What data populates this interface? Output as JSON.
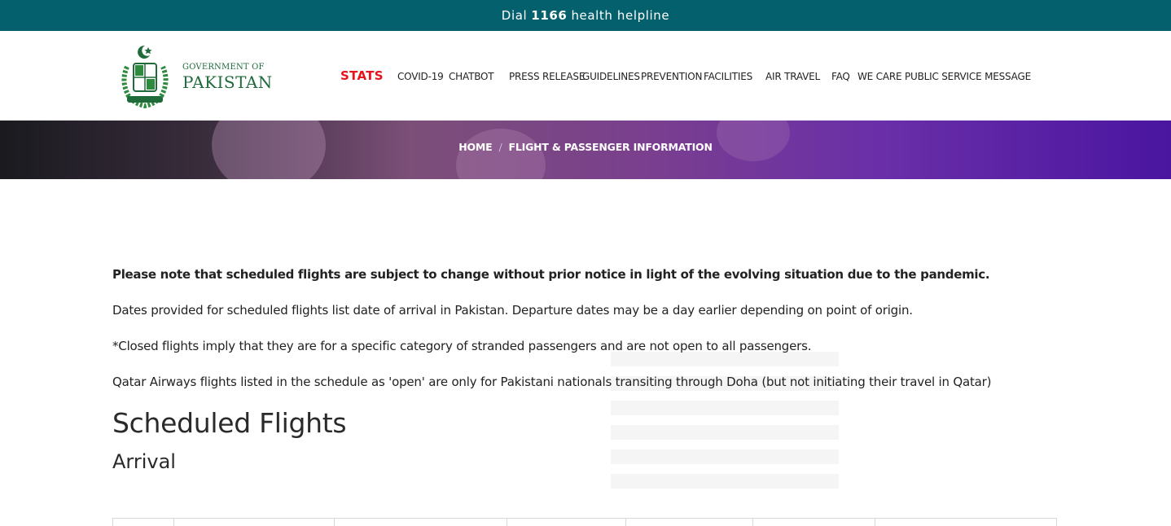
{
  "topbar": {
    "prefix": "Dial",
    "number": "1166",
    "suffix": "health helpline"
  },
  "logo": {
    "line1": "GOVERNMENT OF",
    "line2": "PAKISTAN"
  },
  "nav": {
    "stats": "STATS",
    "covid": "COVID-19",
    "chatbot": "CHATBOT",
    "press": "PRESS RELEASE",
    "guidelines": "GUIDELINES",
    "prevention": "PREVENTION",
    "facilities": "FACILITIES",
    "air_travel": "AIR TRAVEL",
    "faq": "FAQ",
    "we_care": "WE CARE",
    "psm": "PUBLIC SERVICE MESSAGE"
  },
  "breadcrumb": {
    "home": "HOME",
    "separator": "/",
    "current": "FLIGHT & PASSENGER INFORMATION"
  },
  "notes": {
    "bold": "Please note that scheduled flights are subject to change without prior notice in light of the evolving situation due to the pandemic.",
    "dates": "Dates provided for scheduled flights list date of arrival in Pakistan. Departure dates may be a day earlier depending on point of origin.",
    "closed": "*Closed flights imply that they are for a specific category of stranded passengers and are not open to all passengers.",
    "qatar": "Qatar Airways flights listed in the schedule as 'open' are only for Pakistani nationals transiting through Doha (but not initiating their travel in Qatar)"
  },
  "headings": {
    "scheduled": "Scheduled Flights",
    "arrival": "Arrival"
  },
  "colors": {
    "topbar": "#04606c",
    "stats": "#e8121b",
    "logo_green": "#1f6b3a"
  }
}
